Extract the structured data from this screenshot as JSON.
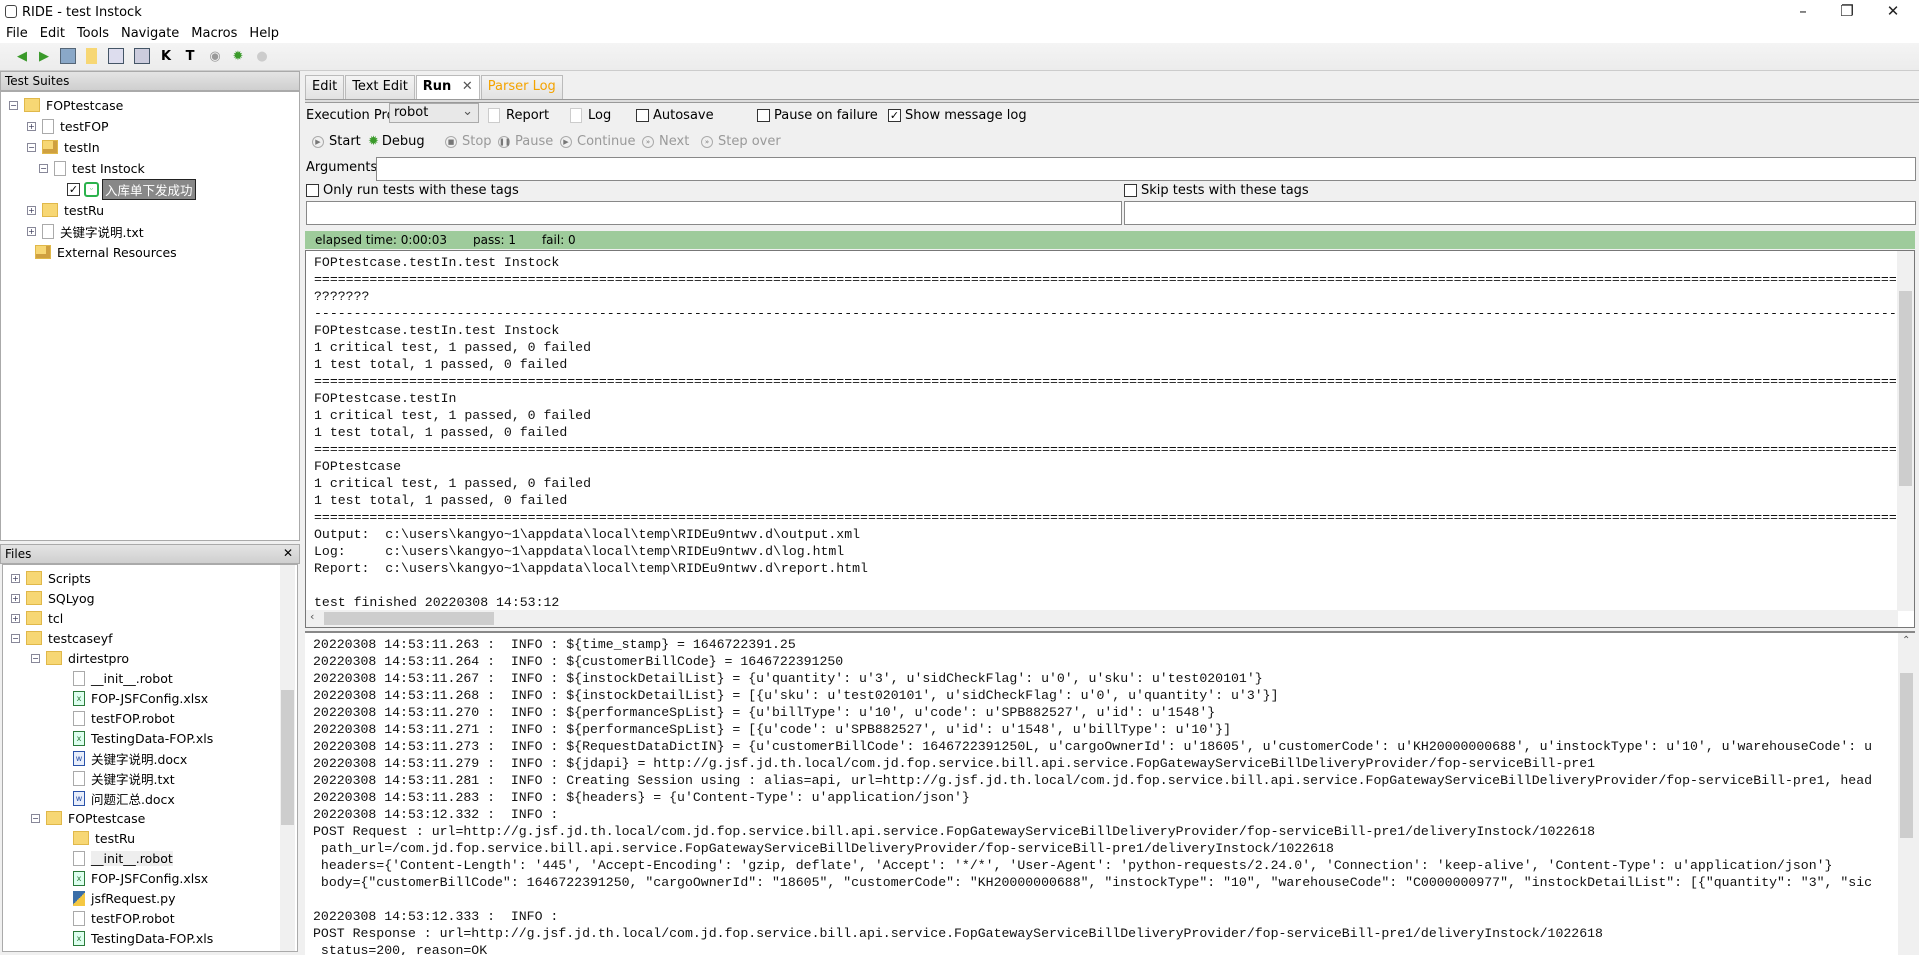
{
  "window": {
    "title": "RIDE - test Instock",
    "minimize": "–",
    "restore": "❐",
    "close": "✕"
  },
  "menu": [
    "File",
    "Edit",
    "Tools",
    "Navigate",
    "Macros",
    "Help"
  ],
  "toolbar": {
    "icons": [
      "back-arrow-icon",
      "forward-arrow-icon",
      "open-icon",
      "folder-icon",
      "save-icon",
      "save-all-icon",
      "keyword-search-icon",
      "test-search-icon",
      "run-icon",
      "debug-bug-icon",
      "stop-icon"
    ],
    "k": "K",
    "t": "T"
  },
  "test_suites": {
    "title": "Test Suites",
    "items": [
      {
        "label": "FOPtestcase",
        "exp": "−"
      },
      {
        "label": "testFOP",
        "exp": "+"
      },
      {
        "label": "testIn",
        "exp": "−"
      },
      {
        "label": "test Instock",
        "exp": "−"
      },
      {
        "label": "入库单下发成功",
        "checked": "✓"
      },
      {
        "label": "testRu",
        "exp": "+"
      },
      {
        "label": "关键字说明.txt",
        "exp": "+"
      },
      {
        "label": "External Resources"
      }
    ]
  },
  "files": {
    "title": "Files",
    "close": "✕",
    "items": [
      {
        "label": "Scripts",
        "exp": "+"
      },
      {
        "label": "SQLyog",
        "exp": "+"
      },
      {
        "label": "tcl",
        "exp": "+"
      },
      {
        "label": "testcaseyf",
        "exp": "−"
      },
      {
        "label": "dirtestpro",
        "exp": "−"
      },
      {
        "label": "__init__.robot"
      },
      {
        "label": "FOP-JSFConfig.xlsx"
      },
      {
        "label": "testFOP.robot"
      },
      {
        "label": "TestingData-FOP.xls"
      },
      {
        "label": "关键字说明.docx"
      },
      {
        "label": "关键字说明.txt"
      },
      {
        "label": "问题汇总.docx"
      },
      {
        "label": "FOPtestcase",
        "exp": "−"
      },
      {
        "label": "testRu"
      },
      {
        "label": "__init__.robot"
      },
      {
        "label": "FOP-JSFConfig.xlsx"
      },
      {
        "label": "jsfRequest.py"
      },
      {
        "label": "testFOP.robot"
      },
      {
        "label": "TestingData-FOP.xls"
      }
    ]
  },
  "tabs": [
    {
      "label": "Edit"
    },
    {
      "label": "Text Edit"
    },
    {
      "label": "Run",
      "close": "✕"
    },
    {
      "label": "Parser Log"
    }
  ],
  "run": {
    "profile_label": "Execution Profile:",
    "profile_value": "robot",
    "report": "Report",
    "log": "Log",
    "autosave": "Autosave",
    "pause_on_failure": "Pause on failure",
    "show_message_log": "Show message log",
    "show_message_log_checked": "✓",
    "start": "Start",
    "debug": "Debug",
    "stop": "Stop",
    "pause": "Pause",
    "continue": "Continue",
    "next": "Next",
    "step_over": "Step over",
    "arguments_label": "Arguments:",
    "arguments_value": "",
    "only_run_tags": "Only run tests with these tags",
    "skip_tags": "Skip tests with these tags"
  },
  "status": {
    "elapsed": "elapsed time: 0:00:03",
    "pass": "pass: 1",
    "fail": "fail: 0",
    "color": "#9ecb9b"
  },
  "output": "FOPtestcase.testIn.test Instock\n==============================================================================================================================================================================================================\n???????\n--------------------------------------------------------------------------------------------------------------------------------------------------------------------------------------------------------------------------------\nFOPtestcase.testIn.test Instock\n1 critical test, 1 passed, 0 failed\n1 test total, 1 passed, 0 failed\n==============================================================================================================================================================================================================\nFOPtestcase.testIn\n1 critical test, 1 passed, 0 failed\n1 test total, 1 passed, 0 failed\n==============================================================================================================================================================================================================\nFOPtestcase\n1 critical test, 1 passed, 0 failed\n1 test total, 1 passed, 0 failed\n==============================================================================================================================================================================================================\nOutput:  c:\\users\\kangyo~1\\appdata\\local\\temp\\RIDEu9ntwv.d\\output.xml\nLog:     c:\\users\\kangyo~1\\appdata\\local\\temp\\RIDEu9ntwv.d\\log.html\nReport:  c:\\users\\kangyo~1\\appdata\\local\\temp\\RIDEu9ntwv.d\\report.html\n\ntest finished 20220308 14:53:12",
  "message_log": "20220308 14:53:11.263 :  INFO : ${time_stamp} = 1646722391.25\n20220308 14:53:11.264 :  INFO : ${customerBillCode} = 1646722391250\n20220308 14:53:11.267 :  INFO : ${instockDetailList} = {u'quantity': u'3', u'sidCheckFlag': u'0', u'sku': u'test020101'}\n20220308 14:53:11.268 :  INFO : ${instockDetailList} = [{u'sku': u'test020101', u'sidCheckFlag': u'0', u'quantity': u'3'}]\n20220308 14:53:11.270 :  INFO : ${performanceSpList} = {u'billType': u'10', u'code': u'SPB882527', u'id': u'1548'}\n20220308 14:53:11.271 :  INFO : ${performanceSpList} = [{u'code': u'SPB882527', u'id': u'1548', u'billType': u'10'}]\n20220308 14:53:11.273 :  INFO : ${RequestDataDictIN} = {u'customerBillCode': 1646722391250L, u'cargoOwnerId': u'18605', u'customerCode': u'KH20000000688', u'instockType': u'10', u'warehouseCode': u\n20220308 14:53:11.279 :  INFO : ${jdapi} = http://g.jsf.jd.th.local/com.jd.fop.service.bill.api.service.FopGatewayServiceBillDeliveryProvider/fop-serviceBill-pre1\n20220308 14:53:11.281 :  INFO : Creating Session using : alias=api, url=http://g.jsf.jd.th.local/com.jd.fop.service.bill.api.service.FopGatewayServiceBillDeliveryProvider/fop-serviceBill-pre1, head\n20220308 14:53:11.283 :  INFO : ${headers} = {u'Content-Type': u'application/json'}\n20220308 14:53:12.332 :  INFO : \nPOST Request : url=http://g.jsf.jd.th.local/com.jd.fop.service.bill.api.service.FopGatewayServiceBillDeliveryProvider/fop-serviceBill-pre1/deliveryInstock/1022618\n path_url=/com.jd.fop.service.bill.api.service.FopGatewayServiceBillDeliveryProvider/fop-serviceBill-pre1/deliveryInstock/1022618\n headers={'Content-Length': '445', 'Accept-Encoding': 'gzip, deflate', 'Accept': '*/*', 'User-Agent': 'python-requests/2.24.0', 'Connection': 'keep-alive', 'Content-Type': u'application/json'}\n body={\"customerBillCode\": 1646722391250, \"cargoOwnerId\": \"18605\", \"customerCode\": \"KH20000000688\", \"instockType\": \"10\", \"warehouseCode\": \"C0000000977\", \"instockDetailList\": [{\"quantity\": \"3\", \"sic\n\n20220308 14:53:12.333 :  INFO : \nPOST Response : url=http://g.jsf.jd.th.local/com.jd.fop.service.bill.api.service.FopGatewayServiceBillDeliveryProvider/fop-serviceBill-pre1/deliveryInstock/1022618\n status=200, reason=OK"
}
